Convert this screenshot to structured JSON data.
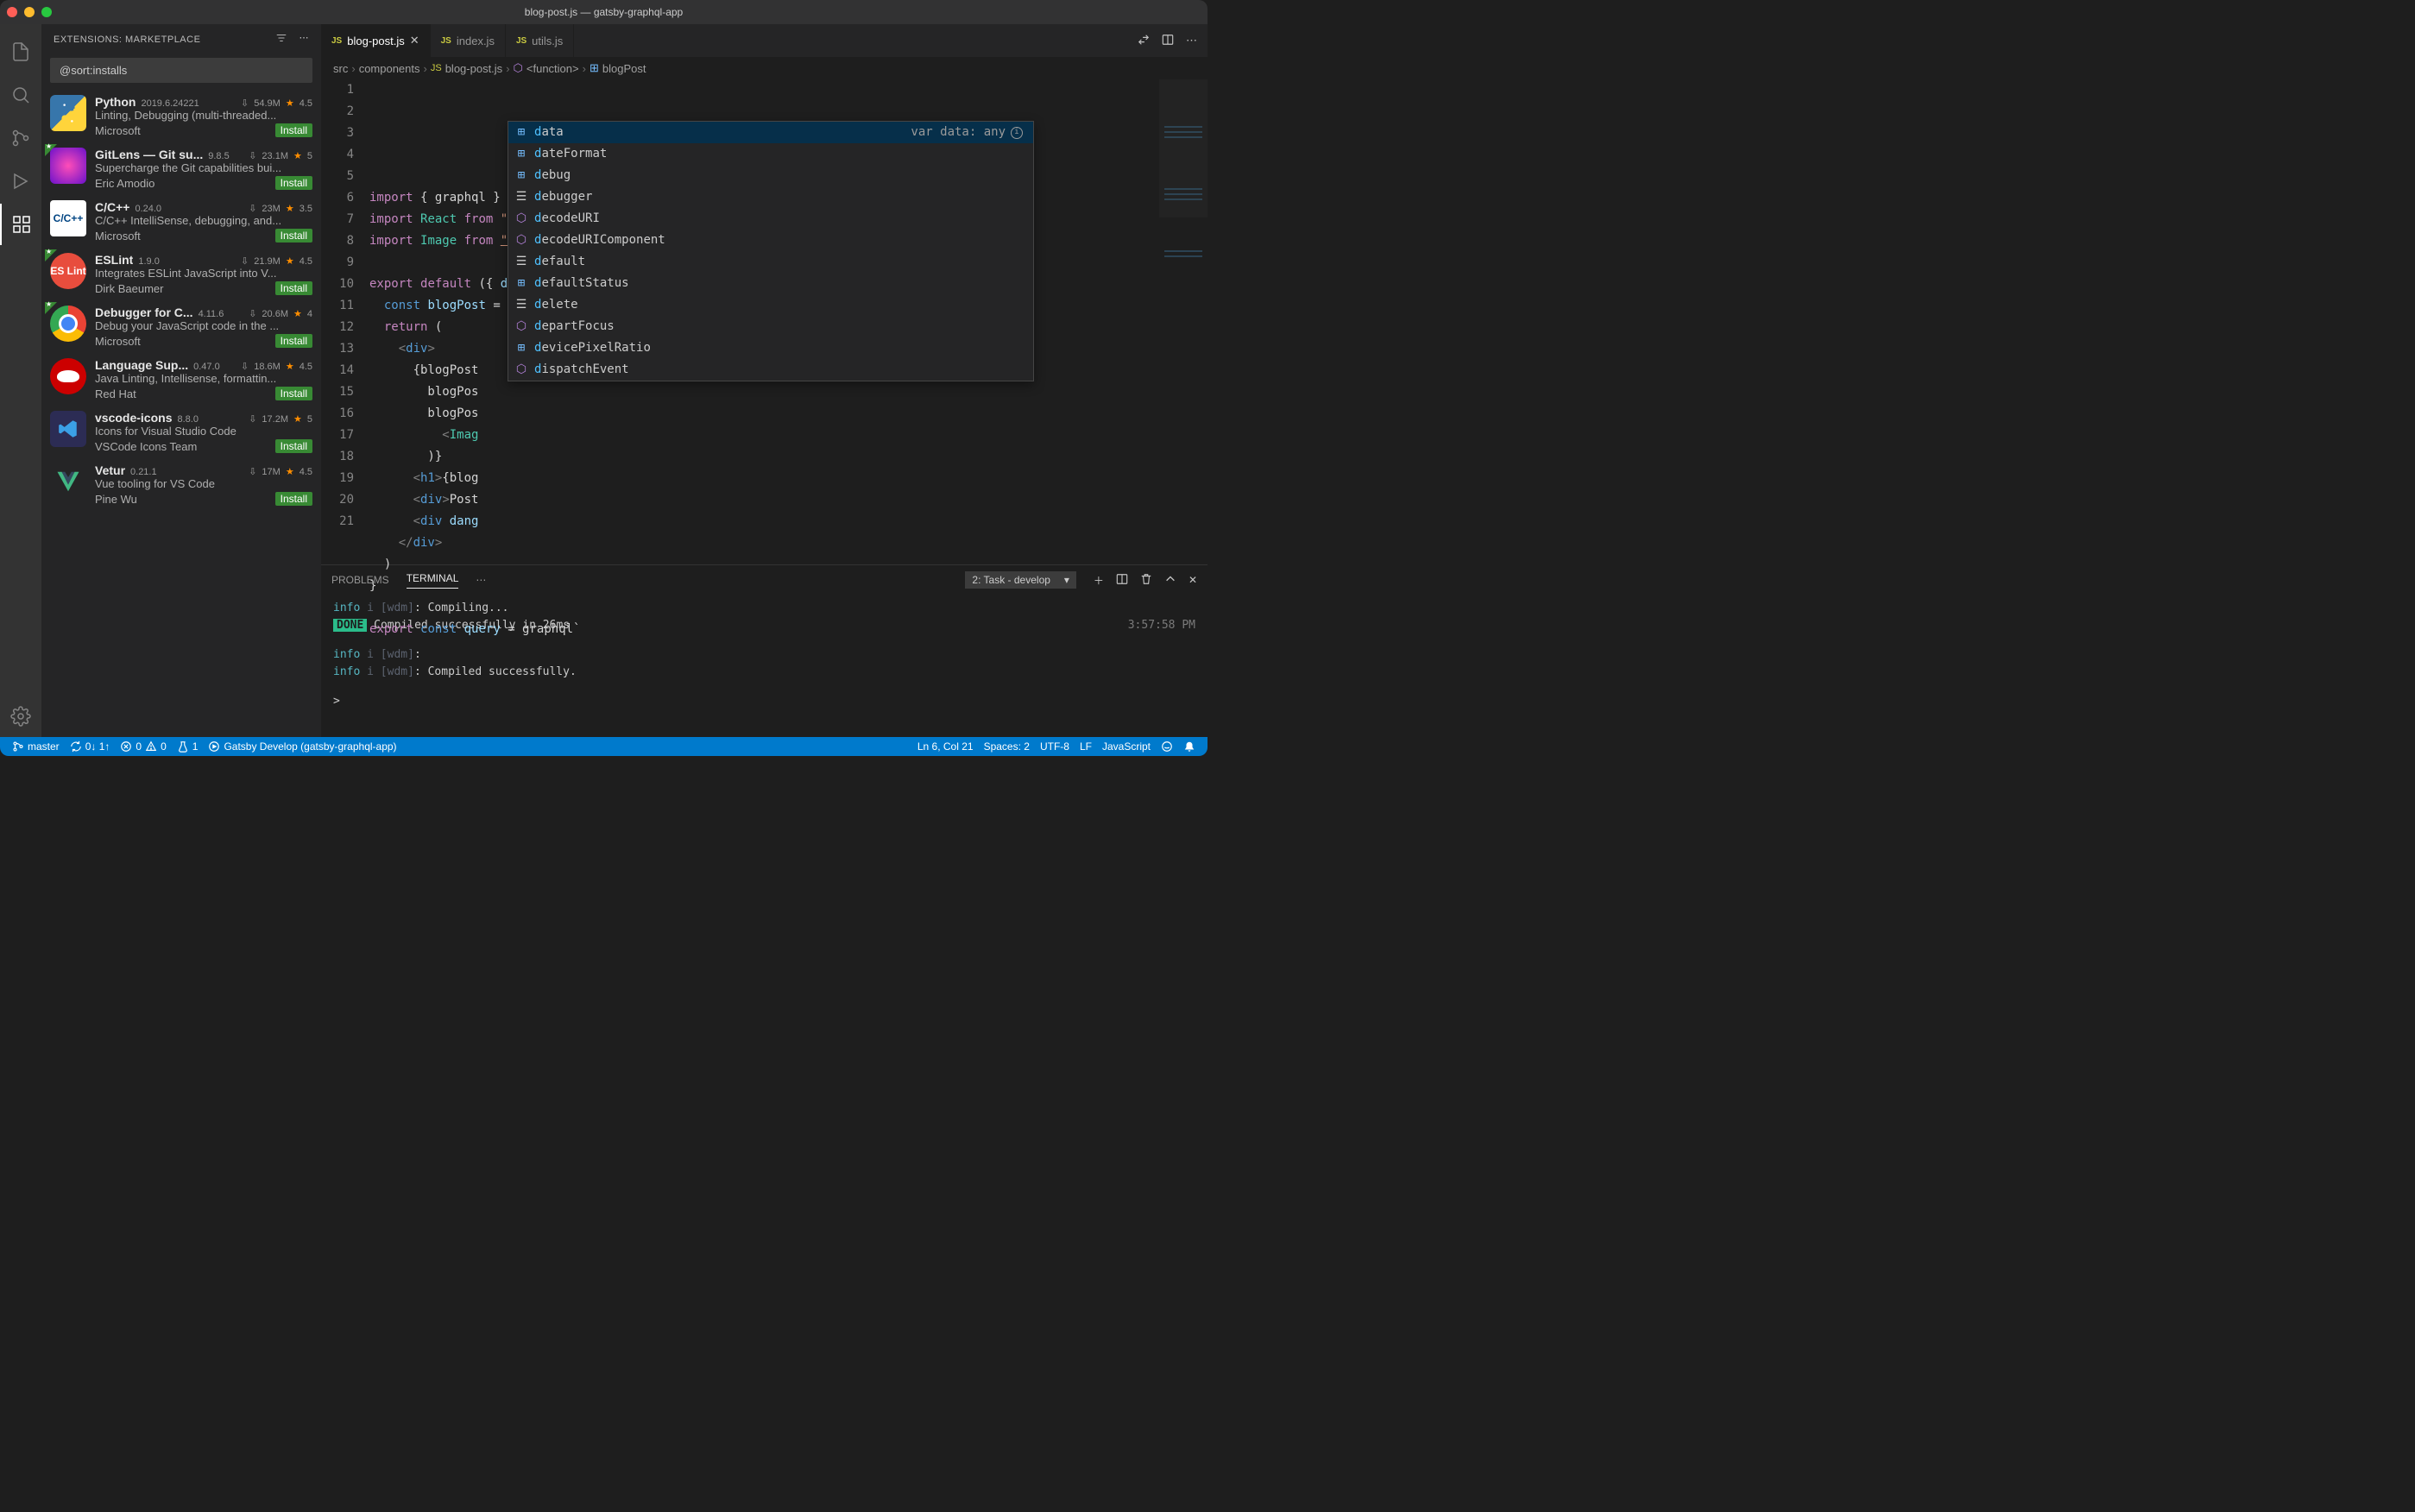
{
  "title": "blog-post.js — gatsby-graphql-app",
  "sidebar": {
    "title": "EXTENSIONS: MARKETPLACE",
    "search_value": "@sort:installs",
    "items": [
      {
        "name": "Python",
        "version": "2019.6.24221",
        "downloads": "54.9M",
        "stars": "4.5",
        "desc": "Linting, Debugging (multi-threaded...",
        "publisher": "Microsoft",
        "install": "Install",
        "badge": false,
        "iconClass": "python"
      },
      {
        "name": "GitLens — Git su...",
        "version": "9.8.5",
        "downloads": "23.1M",
        "stars": "5",
        "desc": "Supercharge the Git capabilities bui...",
        "publisher": "Eric Amodio",
        "install": "Install",
        "badge": true,
        "iconClass": "gitlens"
      },
      {
        "name": "C/C++",
        "version": "0.24.0",
        "downloads": "23M",
        "stars": "3.5",
        "desc": "C/C++ IntelliSense, debugging, and...",
        "publisher": "Microsoft",
        "install": "Install",
        "badge": false,
        "iconClass": "cpp",
        "iconText": "C/C++"
      },
      {
        "name": "ESLint",
        "version": "1.9.0",
        "downloads": "21.9M",
        "stars": "4.5",
        "desc": "Integrates ESLint JavaScript into V...",
        "publisher": "Dirk Baeumer",
        "install": "Install",
        "badge": true,
        "iconClass": "eslint",
        "iconText": "ES\nLint"
      },
      {
        "name": "Debugger for C...",
        "version": "4.11.6",
        "downloads": "20.6M",
        "stars": "4",
        "desc": "Debug your JavaScript code in the ...",
        "publisher": "Microsoft",
        "install": "Install",
        "badge": true,
        "iconClass": "chrome"
      },
      {
        "name": "Language Sup...",
        "version": "0.47.0",
        "downloads": "18.6M",
        "stars": "4.5",
        "desc": "Java Linting, Intellisense, formattin...",
        "publisher": "Red Hat",
        "install": "Install",
        "badge": false,
        "iconClass": "redhat"
      },
      {
        "name": "vscode-icons",
        "version": "8.8.0",
        "downloads": "17.2M",
        "stars": "5",
        "desc": "Icons for Visual Studio Code",
        "publisher": "VSCode Icons Team",
        "install": "Install",
        "badge": false,
        "iconClass": "vsicons"
      },
      {
        "name": "Vetur",
        "version": "0.21.1",
        "downloads": "17M",
        "stars": "4.5",
        "desc": "Vue tooling for VS Code",
        "publisher": "Pine Wu",
        "install": "Install",
        "badge": false,
        "iconClass": "vetur"
      }
    ]
  },
  "tabs": [
    {
      "label": "blog-post.js",
      "active": true,
      "close": true
    },
    {
      "label": "index.js",
      "active": false,
      "close": false
    },
    {
      "label": "utils.js",
      "active": false,
      "close": false
    }
  ],
  "breadcrumbs": {
    "parts": [
      "src",
      "components",
      "blog-post.js",
      "<function>",
      "blogPost"
    ]
  },
  "code_lines": [
    {
      "n": 1,
      "html": "<span class='kw'>import</span> { graphql } <span class='kw'>from</span> <span class='str'>'gatsby'</span>"
    },
    {
      "n": 2,
      "html": "<span class='kw'>import</span> <span class='fn'>React</span> <span class='kw'>from</span> <span class='str'>\"react\"</span>"
    },
    {
      "n": 3,
      "html": "<span class='kw'>import</span> <span class='fn'>Image</span> <span class='kw'>from</span> <span class='str-u'>\"gatsby-image\"</span>"
    },
    {
      "n": 4,
      "html": ""
    },
    {
      "n": 5,
      "html": "<span class='kw'>export</span> <span class='kw'>default</span> ({ <span class='var'>data</span> }) <span class='kw2'>=&gt;</span> {"
    },
    {
      "n": 6,
      "html": "  <span class='kw2'>const</span> <span class='var'>blogPost</span> = <span class='var'>d</span>ata.cms.blogPost"
    },
    {
      "n": 7,
      "html": "  <span class='kw'>return</span> ("
    },
    {
      "n": 8,
      "html": "    <span class='tag'>&lt;</span><span class='tagn'>div</span><span class='tag'>&gt;</span>"
    },
    {
      "n": 9,
      "html": "      {blogPost"
    },
    {
      "n": 10,
      "html": "        blogPos"
    },
    {
      "n": 11,
      "html": "        blogPos"
    },
    {
      "n": 12,
      "html": "          <span class='tag'>&lt;</span><span class='fn'>Imag</span>"
    },
    {
      "n": 13,
      "html": "        )}"
    },
    {
      "n": 14,
      "html": "      <span class='tag'>&lt;</span><span class='tagn'>h1</span><span class='tag'>&gt;</span>{blog"
    },
    {
      "n": 15,
      "html": "      <span class='tag'>&lt;</span><span class='tagn'>div</span><span class='tag'>&gt;</span>Post"
    },
    {
      "n": 16,
      "html": "      <span class='tag'>&lt;</span><span class='tagn'>div</span> <span class='var'>dang</span>"
    },
    {
      "n": 17,
      "html": "    <span class='tag'>&lt;/</span><span class='tagn'>div</span><span class='tag'>&gt;</span>"
    },
    {
      "n": 18,
      "html": "  )"
    },
    {
      "n": 19,
      "html": "}"
    },
    {
      "n": 20,
      "html": ""
    },
    {
      "n": 21,
      "html": "<span class='kw'>export</span> <span class='kw2'>const</span> <span class='var'>query</span> = graphql`"
    }
  ],
  "suggestions": {
    "detail": "var data: any",
    "items": [
      {
        "label": "data",
        "icon": "var",
        "selected": true
      },
      {
        "label": "dateFormat",
        "icon": "var"
      },
      {
        "label": "debug",
        "icon": "var"
      },
      {
        "label": "debugger",
        "icon": "snip"
      },
      {
        "label": "decodeURI",
        "icon": "purple"
      },
      {
        "label": "decodeURIComponent",
        "icon": "purple"
      },
      {
        "label": "default",
        "icon": "snip"
      },
      {
        "label": "defaultStatus",
        "icon": "var"
      },
      {
        "label": "delete",
        "icon": "snip"
      },
      {
        "label": "departFocus",
        "icon": "purple"
      },
      {
        "label": "devicePixelRatio",
        "icon": "var"
      },
      {
        "label": "dispatchEvent",
        "icon": "purple"
      }
    ]
  },
  "panel": {
    "tabs": {
      "problems": "PROBLEMS",
      "terminal": "TERMINAL"
    },
    "select": "2: Task - develop",
    "terminal": {
      "l1_info": "info",
      "l1_i": "i",
      "l1_wdm": "[wdm]",
      "l1_text": ": Compiling...",
      "l2_done": "DONE",
      "l2_text": " Compiled successfully in 26ms",
      "l2_time": "3:57:58 PM",
      "l3_info": "info",
      "l3_i": "i",
      "l3_wdm": "[wdm]",
      "l3_text": ":",
      "l4_info": "info",
      "l4_i": "i",
      "l4_wdm": "[wdm]",
      "l4_text": ": Compiled successfully.",
      "prompt": ">"
    }
  },
  "status": {
    "branch": "master",
    "sync": "0↓ 1↑",
    "errors": "0",
    "warnings": "0",
    "tests": "1",
    "task": "Gatsby Develop (gatsby-graphql-app)",
    "ln": "Ln 6, Col 21",
    "spaces": "Spaces: 2",
    "encoding": "UTF-8",
    "eol": "LF",
    "lang": "JavaScript"
  }
}
